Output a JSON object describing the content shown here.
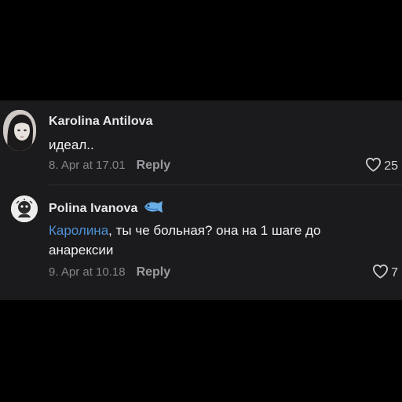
{
  "comments": [
    {
      "author": "Karolina Antilova",
      "text": "идеал..",
      "date": "8. Apr at 17.01",
      "reply_label": "Reply",
      "likes": "25",
      "avatar_icon": "user-photo-avatar"
    },
    {
      "author": "Polina Ivanova",
      "badge_icon": "fish-emoji-icon",
      "mention": "Каролина",
      "text": ", ты че больная? она на 1 шаге до анарексии",
      "date": "9. Apr at 10.18",
      "reply_label": "Reply",
      "likes": "7",
      "avatar_icon": "cartoon-avatar"
    }
  ],
  "colors": {
    "background": "#000000",
    "panel": "#1b1b1d",
    "mention": "#4e90d4",
    "meta_text": "#858589"
  }
}
